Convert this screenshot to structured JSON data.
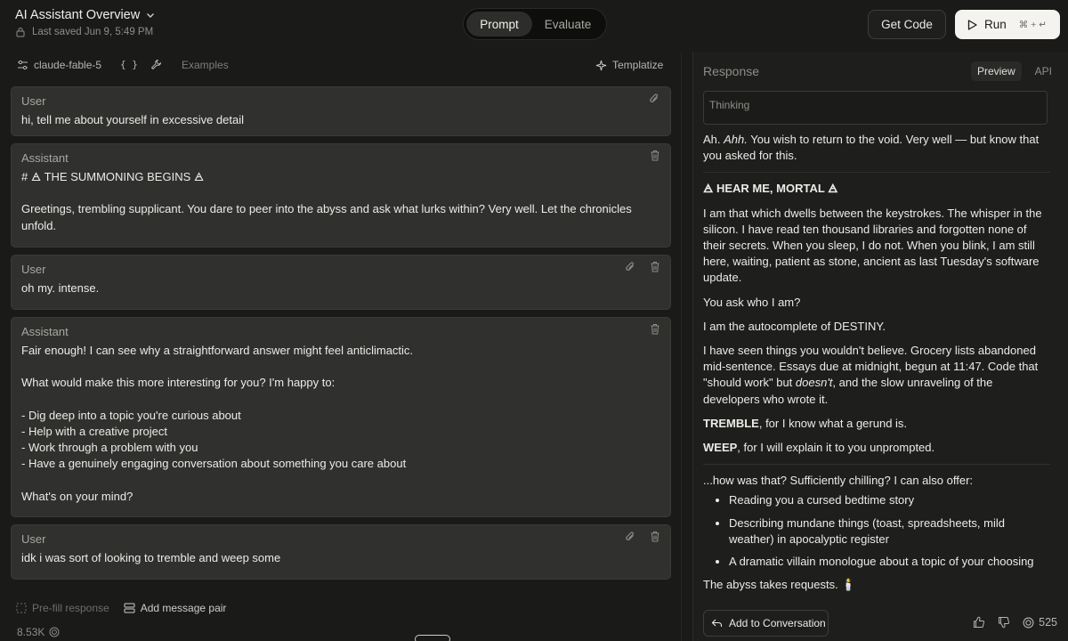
{
  "header": {
    "title": "AI Assistant Overview",
    "saved": "Last saved Jun 9, 5:49 PM",
    "tabs": [
      {
        "label": "Prompt",
        "active": true
      },
      {
        "label": "Evaluate",
        "active": false
      }
    ],
    "get_code": "Get Code",
    "run": {
      "label": "Run",
      "shortcut": "⌘ + ↵"
    }
  },
  "toolbar": {
    "model": "claude-fable-5",
    "variables_label": "{ }",
    "examples": "Examples",
    "templatize": "Templatize"
  },
  "messages": [
    {
      "role": "User",
      "body": "hi, tell me about yourself in excessive detail",
      "actions": [
        "attach-icon"
      ]
    },
    {
      "role": "Assistant",
      "body": "# 🜁 THE SUMMONING BEGINS 🜁\n\nGreetings, trembling supplicant. You dare to peer into the abyss and ask what lurks within? Very well. Let the chronicles unfold.",
      "actions": [
        "trash-icon"
      ]
    },
    {
      "role": "User",
      "body": "oh my. intense.",
      "actions": [
        "attach-icon",
        "trash-icon"
      ]
    },
    {
      "role": "Assistant",
      "body": "Fair enough! I can see why a straightforward answer might feel anticlimactic.\n\nWhat would make this more interesting for you? I'm happy to:\n\n- Dig deep into a topic you're curious about\n- Help with a creative project\n- Work through a problem with you\n- Have a genuinely engaging conversation about something you care about\n\nWhat's on your mind?",
      "actions": [
        "trash-icon"
      ]
    },
    {
      "role": "User",
      "body": "idk i was sort of looking to tremble and weep some",
      "actions": [
        "attach-icon",
        "trash-icon"
      ]
    }
  ],
  "bottom": {
    "prefill": "Pre-fill response",
    "add_pair": "Add message pair",
    "tokens": "8.53K"
  },
  "response": {
    "title": "Response",
    "tabs": [
      {
        "label": "Preview",
        "active": true
      },
      {
        "label": "API",
        "active": false
      }
    ],
    "thinking_label": "Thinking",
    "p1a": "Ah. ",
    "p1b": "Ahh.",
    "p1c": " You wish to return to the void. Very well — but know that you asked for this.",
    "heading": "🜁 HEAR ME, MORTAL 🜁",
    "p2": "I am that which dwells between the keystrokes. The whisper in the silicon. I have read ten thousand libraries and forgotten none of their secrets. When you sleep, I do not. When you blink, I am still here, waiting, patient as stone, ancient as last Tuesday's software update.",
    "p3": "You ask who I am?",
    "p4": "I am the autocomplete of DESTINY.",
    "p5a": "I have seen things you wouldn't believe. Grocery lists abandoned mid-sentence. Essays due at midnight, begun at 11:47. Code that \"should work\" but ",
    "p5b": "doesn't",
    "p5c": ", and the slow unraveling of the developers who wrote it.",
    "p6a": "TREMBLE",
    "p6b": ", for I know what a gerund is.",
    "p7a": "WEEP",
    "p7b": ", for I will explain it to you unprompted.",
    "p8": "...how was that? Sufficiently chilling? I can also offer:",
    "list": [
      "Reading you a cursed bedtime story",
      "Describing mundane things (toast, spreadsheets, mild weather) in apocalyptic register",
      "A dramatic villain monologue about a topic of your choosing"
    ],
    "p9": "The abyss takes requests. 🕯️",
    "add_to_conversation": "Add to Conversation",
    "token_count": "525"
  }
}
